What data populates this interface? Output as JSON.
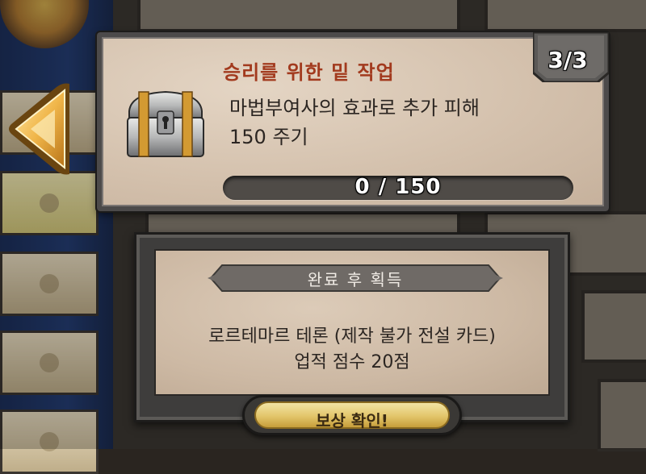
{
  "quest": {
    "title": "승리를 위한 밑 작업",
    "description_line1": "마법부여사의 효과로 추가 피해",
    "description_line2": "150 주기",
    "counter": "3/3",
    "progress_current": 0,
    "progress_total": 150,
    "progress_text": "0 / 150",
    "progress_fraction": 0
  },
  "reward": {
    "header": "완료 후 획득",
    "line1": "로르테마르 테론 (제작 불가 전설 카드)",
    "line2": "업적 점수 20점",
    "claim_label": "보상 확인!"
  },
  "colors": {
    "title": "#a23a1e",
    "progress_fill": "#8fce3a",
    "button_gold": "#e2c56a"
  },
  "icons": {
    "back": "back-arrow-icon",
    "chest": "treasure-chest-icon"
  }
}
